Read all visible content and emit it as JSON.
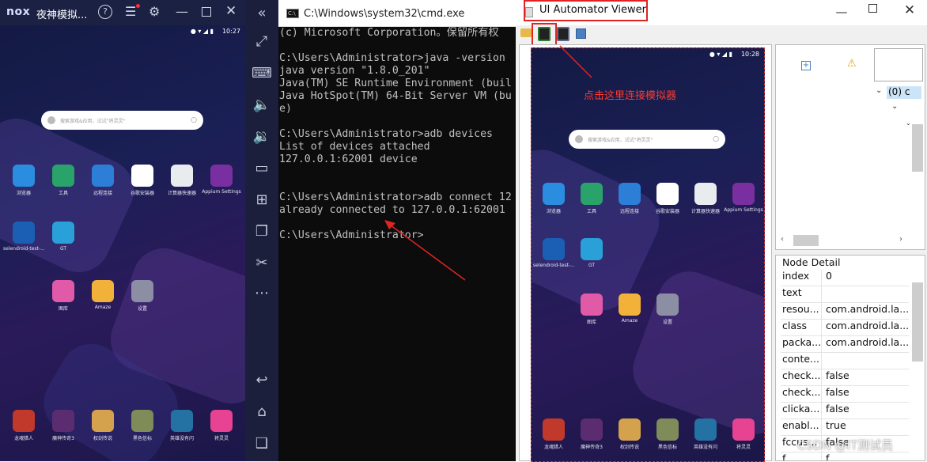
{
  "nox": {
    "brand": "nox",
    "title": "夜神模拟...",
    "status_time": "10:27",
    "search_placeholder": "搜索游戏&应用，试试\"将灵灵\"",
    "apps_row1": [
      {
        "label": "浏览器",
        "icon": "browser-icon",
        "color": "#2a8de0"
      },
      {
        "label": "工具",
        "icon": "tools-icon",
        "color": "#2aa36a"
      },
      {
        "label": "远程连接",
        "icon": "remote-icon",
        "color": "#2c7ed6"
      },
      {
        "label": "谷歌安装器",
        "icon": "google-icon",
        "color": "#ffffff"
      },
      {
        "label": "计算器快速器",
        "icon": "calculator-icon",
        "color": "#e9ecef"
      },
      {
        "label": "Appium Settings",
        "icon": "appium-icon",
        "color": "#7a2fa0"
      }
    ],
    "apps_row2": [
      {
        "label": "selendroid-test-...",
        "icon": "selendroid-icon",
        "color": "#1a5fb4"
      },
      {
        "label": "GT",
        "icon": "gt-icon",
        "color": "#2aa0d8"
      }
    ],
    "apps_row3": [
      {
        "label": "图库",
        "icon": "gallery-icon",
        "color": "#e05aa8"
      },
      {
        "label": "Amaze",
        "icon": "folder-icon",
        "color": "#f2b23a"
      },
      {
        "label": "设置",
        "icon": "settings-icon",
        "color": "#8c8fa3"
      }
    ],
    "dock": [
      {
        "label": "龙魂猎人",
        "icon": "game1-icon",
        "color": "#c0392b"
      },
      {
        "label": "魔神传奇3",
        "icon": "game2-icon",
        "color": "#5b2c6f"
      },
      {
        "label": "权剑传说",
        "icon": "game3-icon",
        "color": "#d4a24c"
      },
      {
        "label": "黑色信标",
        "icon": "game4-icon",
        "color": "#7f8c5a"
      },
      {
        "label": "英雄没有闪",
        "icon": "game5-icon",
        "color": "#2471a3"
      },
      {
        "label": "将灵灵",
        "icon": "game6-icon",
        "color": "#e84393"
      }
    ]
  },
  "cmd": {
    "title": "C:\\Windows\\system32\\cmd.exe",
    "lines": [
      "(c) Microsoft Corporation。保留所有权",
      "",
      "C:\\Users\\Administrator>java -version",
      "java version \"1.8.0_201\"",
      "Java(TM) SE Runtime Environment (buil",
      "Java HotSpot(TM) 64-Bit Server VM (bu",
      "e)",
      "",
      "C:\\Users\\Administrator>adb devices",
      "List of devices attached",
      "127.0.0.1:62001 device",
      "",
      "",
      "C:\\Users\\Administrator>adb connect 12",
      "already connected to 127.0.0.1:62001",
      "",
      "C:\\Users\\Administrator>"
    ]
  },
  "uia": {
    "title": "UI Automator Viewer",
    "annotation": "点击这里连接模拟器",
    "phone_time": "10:28",
    "tree_items": [
      "(0) c"
    ],
    "node_detail_title": "Node Detail",
    "details": [
      {
        "key": "index",
        "value": "0"
      },
      {
        "key": "text",
        "value": ""
      },
      {
        "key": "resou...",
        "value": "com.android.la..."
      },
      {
        "key": "class",
        "value": "com.android.la..."
      },
      {
        "key": "packa...",
        "value": "com.android.la..."
      },
      {
        "key": "conte...",
        "value": ""
      },
      {
        "key": "check...",
        "value": "false"
      },
      {
        "key": "check...",
        "value": "false"
      },
      {
        "key": "clicka...",
        "value": "false"
      },
      {
        "key": "enabl...",
        "value": "true"
      },
      {
        "key": "fccus...",
        "value": "false"
      },
      {
        "key": "f...",
        "value": "f..."
      }
    ],
    "watermark": "CSDN @IT测试员"
  }
}
